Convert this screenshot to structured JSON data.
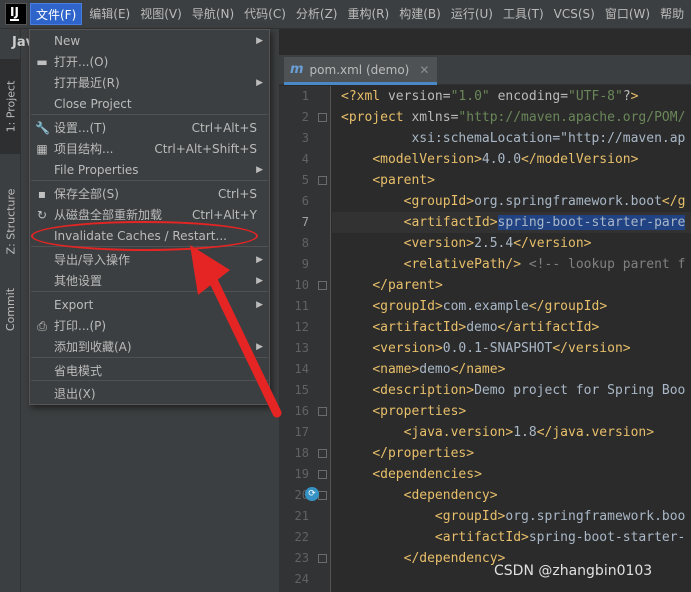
{
  "menubar": {
    "items": [
      {
        "label": "文件(F)",
        "active": true
      },
      {
        "label": "编辑(E)"
      },
      {
        "label": "视图(V)"
      },
      {
        "label": "导航(N)"
      },
      {
        "label": "代码(C)"
      },
      {
        "label": "分析(Z)"
      },
      {
        "label": "重构(R)"
      },
      {
        "label": "构建(B)"
      },
      {
        "label": "运行(U)"
      },
      {
        "label": "工具(T)"
      },
      {
        "label": "VCS(S)"
      },
      {
        "label": "窗口(W)"
      },
      {
        "label": "帮助"
      }
    ]
  },
  "left_strip": {
    "project_tab": "1: Project",
    "structure_tab": "Z: Structure",
    "commit_tab": "Commit",
    "java_label": "Jav"
  },
  "file_menu": {
    "items": [
      {
        "label": "New",
        "submenu": true
      },
      {
        "label": "打开...(O)",
        "icon": "folder-open-icon"
      },
      {
        "label": "打开最近(R)",
        "submenu": true
      },
      {
        "label": "Close Project"
      },
      {
        "label": "设置...(T)",
        "shortcut": "Ctrl+Alt+S",
        "icon": "wrench-icon"
      },
      {
        "label": "项目结构...",
        "shortcut": "Ctrl+Alt+Shift+S",
        "icon": "project-structure-icon"
      },
      {
        "label": "File Properties",
        "submenu": true
      },
      {
        "label": "保存全部(S)",
        "shortcut": "Ctrl+S",
        "icon": "save-icon"
      },
      {
        "label": "从磁盘全部重新加载",
        "shortcut": "Ctrl+Alt+Y",
        "icon": "reload-icon"
      },
      {
        "label": "Invalidate Caches / Restart..."
      },
      {
        "label": "导出/导入操作",
        "submenu": true
      },
      {
        "label": "其他设置",
        "submenu": true
      },
      {
        "label": "Export",
        "submenu": true
      },
      {
        "label": "打印...(P)",
        "icon": "print-icon"
      },
      {
        "label": "添加到收藏(A)",
        "submenu": true
      },
      {
        "label": "省电模式"
      },
      {
        "label": "退出(X)"
      }
    ]
  },
  "editor": {
    "tab_label": "pom.xml (demo)",
    "tab_icon_glyph": "m",
    "line_numbers": [
      "1",
      "2",
      "3",
      "4",
      "5",
      "6",
      "7",
      "8",
      "9",
      "10",
      "11",
      "12",
      "13",
      "14",
      "15",
      "16",
      "17",
      "18",
      "19",
      "20",
      "21",
      "22",
      "23",
      "24"
    ],
    "current_line": 7,
    "lines": [
      "<?xml version=\"1.0\" encoding=\"UTF-8\"?>",
      "<project xmlns=\"http://maven.apache.org/POM/",
      "         xsi:schemaLocation=\"http://maven.ap",
      "    <modelVersion>4.0.0</modelVersion>",
      "    <parent>",
      "        <groupId>org.springframework.boot</g",
      "        <artifactId>spring-boot-starter-pare",
      "        <version>2.5.4</version>",
      "        <relativePath/> <!-- lookup parent f",
      "    </parent>",
      "    <groupId>com.example</groupId>",
      "    <artifactId>demo</artifactId>",
      "    <version>0.0.1-SNAPSHOT</version>",
      "    <name>demo</name>",
      "    <description>Demo project for Spring Boo",
      "    <properties>",
      "        <java.version>1.8</java.version>",
      "    </properties>",
      "    <dependencies>",
      "        <dependency>",
      "            <groupId>org.springframework.boo",
      "            <artifactId>spring-boot-starter-",
      "        </dependency>",
      ""
    ]
  },
  "watermark": "CSDN @zhangbin0103",
  "colors": {
    "menu_highlight": "#2f65ca",
    "annotation_red": "#e52424",
    "xml_tag": "#e8bf6a",
    "xml_value": "#6a8759"
  }
}
